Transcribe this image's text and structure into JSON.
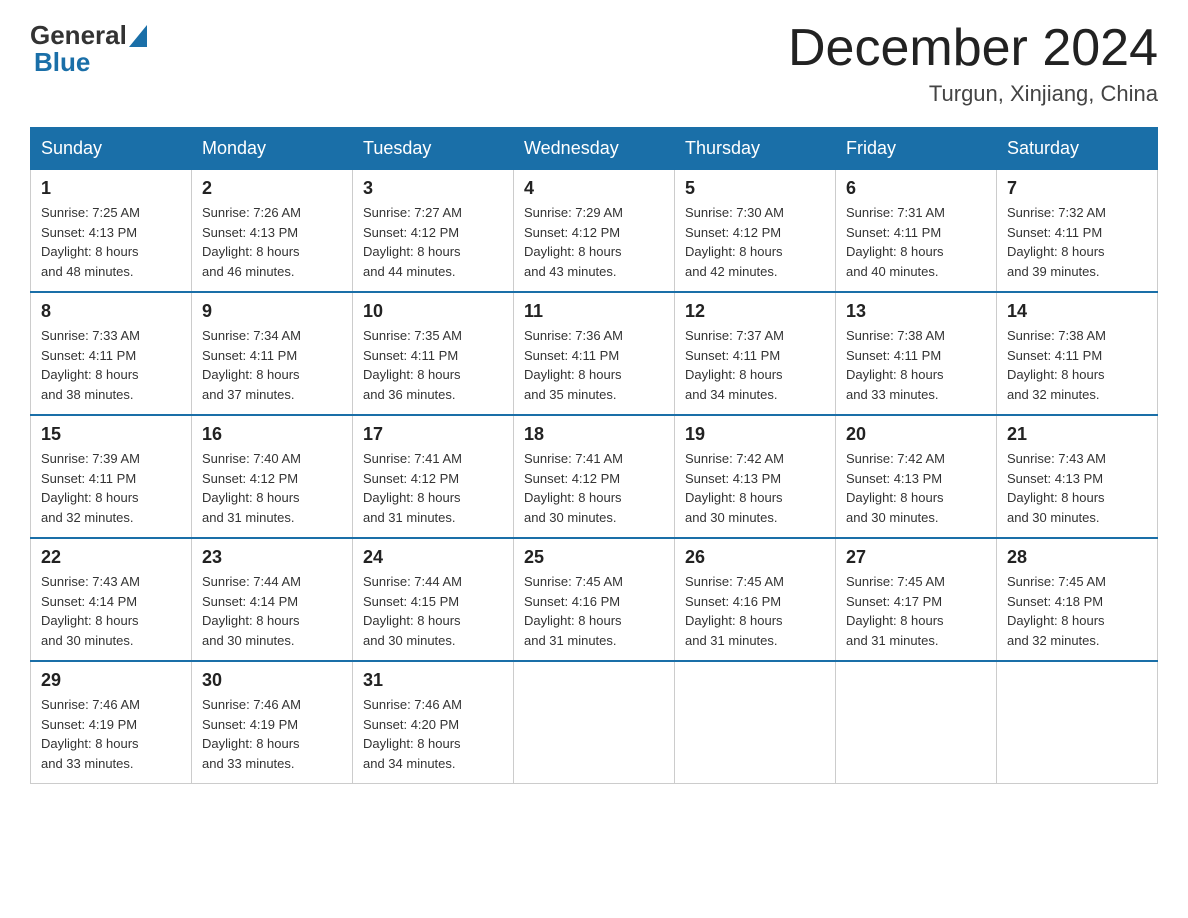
{
  "header": {
    "logo_general": "General",
    "logo_blue": "Blue",
    "month_year": "December 2024",
    "location": "Turgun, Xinjiang, China"
  },
  "weekdays": [
    "Sunday",
    "Monday",
    "Tuesday",
    "Wednesday",
    "Thursday",
    "Friday",
    "Saturday"
  ],
  "weeks": [
    [
      {
        "day": "1",
        "sunrise": "7:25 AM",
        "sunset": "4:13 PM",
        "daylight": "8 hours and 48 minutes."
      },
      {
        "day": "2",
        "sunrise": "7:26 AM",
        "sunset": "4:13 PM",
        "daylight": "8 hours and 46 minutes."
      },
      {
        "day": "3",
        "sunrise": "7:27 AM",
        "sunset": "4:12 PM",
        "daylight": "8 hours and 44 minutes."
      },
      {
        "day": "4",
        "sunrise": "7:29 AM",
        "sunset": "4:12 PM",
        "daylight": "8 hours and 43 minutes."
      },
      {
        "day": "5",
        "sunrise": "7:30 AM",
        "sunset": "4:12 PM",
        "daylight": "8 hours and 42 minutes."
      },
      {
        "day": "6",
        "sunrise": "7:31 AM",
        "sunset": "4:11 PM",
        "daylight": "8 hours and 40 minutes."
      },
      {
        "day": "7",
        "sunrise": "7:32 AM",
        "sunset": "4:11 PM",
        "daylight": "8 hours and 39 minutes."
      }
    ],
    [
      {
        "day": "8",
        "sunrise": "7:33 AM",
        "sunset": "4:11 PM",
        "daylight": "8 hours and 38 minutes."
      },
      {
        "day": "9",
        "sunrise": "7:34 AM",
        "sunset": "4:11 PM",
        "daylight": "8 hours and 37 minutes."
      },
      {
        "day": "10",
        "sunrise": "7:35 AM",
        "sunset": "4:11 PM",
        "daylight": "8 hours and 36 minutes."
      },
      {
        "day": "11",
        "sunrise": "7:36 AM",
        "sunset": "4:11 PM",
        "daylight": "8 hours and 35 minutes."
      },
      {
        "day": "12",
        "sunrise": "7:37 AM",
        "sunset": "4:11 PM",
        "daylight": "8 hours and 34 minutes."
      },
      {
        "day": "13",
        "sunrise": "7:38 AM",
        "sunset": "4:11 PM",
        "daylight": "8 hours and 33 minutes."
      },
      {
        "day": "14",
        "sunrise": "7:38 AM",
        "sunset": "4:11 PM",
        "daylight": "8 hours and 32 minutes."
      }
    ],
    [
      {
        "day": "15",
        "sunrise": "7:39 AM",
        "sunset": "4:11 PM",
        "daylight": "8 hours and 32 minutes."
      },
      {
        "day": "16",
        "sunrise": "7:40 AM",
        "sunset": "4:12 PM",
        "daylight": "8 hours and 31 minutes."
      },
      {
        "day": "17",
        "sunrise": "7:41 AM",
        "sunset": "4:12 PM",
        "daylight": "8 hours and 31 minutes."
      },
      {
        "day": "18",
        "sunrise": "7:41 AM",
        "sunset": "4:12 PM",
        "daylight": "8 hours and 30 minutes."
      },
      {
        "day": "19",
        "sunrise": "7:42 AM",
        "sunset": "4:13 PM",
        "daylight": "8 hours and 30 minutes."
      },
      {
        "day": "20",
        "sunrise": "7:42 AM",
        "sunset": "4:13 PM",
        "daylight": "8 hours and 30 minutes."
      },
      {
        "day": "21",
        "sunrise": "7:43 AM",
        "sunset": "4:13 PM",
        "daylight": "8 hours and 30 minutes."
      }
    ],
    [
      {
        "day": "22",
        "sunrise": "7:43 AM",
        "sunset": "4:14 PM",
        "daylight": "8 hours and 30 minutes."
      },
      {
        "day": "23",
        "sunrise": "7:44 AM",
        "sunset": "4:14 PM",
        "daylight": "8 hours and 30 minutes."
      },
      {
        "day": "24",
        "sunrise": "7:44 AM",
        "sunset": "4:15 PM",
        "daylight": "8 hours and 30 minutes."
      },
      {
        "day": "25",
        "sunrise": "7:45 AM",
        "sunset": "4:16 PM",
        "daylight": "8 hours and 31 minutes."
      },
      {
        "day": "26",
        "sunrise": "7:45 AM",
        "sunset": "4:16 PM",
        "daylight": "8 hours and 31 minutes."
      },
      {
        "day": "27",
        "sunrise": "7:45 AM",
        "sunset": "4:17 PM",
        "daylight": "8 hours and 31 minutes."
      },
      {
        "day": "28",
        "sunrise": "7:45 AM",
        "sunset": "4:18 PM",
        "daylight": "8 hours and 32 minutes."
      }
    ],
    [
      {
        "day": "29",
        "sunrise": "7:46 AM",
        "sunset": "4:19 PM",
        "daylight": "8 hours and 33 minutes."
      },
      {
        "day": "30",
        "sunrise": "7:46 AM",
        "sunset": "4:19 PM",
        "daylight": "8 hours and 33 minutes."
      },
      {
        "day": "31",
        "sunrise": "7:46 AM",
        "sunset": "4:20 PM",
        "daylight": "8 hours and 34 minutes."
      },
      null,
      null,
      null,
      null
    ]
  ],
  "labels": {
    "sunrise": "Sunrise:",
    "sunset": "Sunset:",
    "daylight": "Daylight:"
  }
}
